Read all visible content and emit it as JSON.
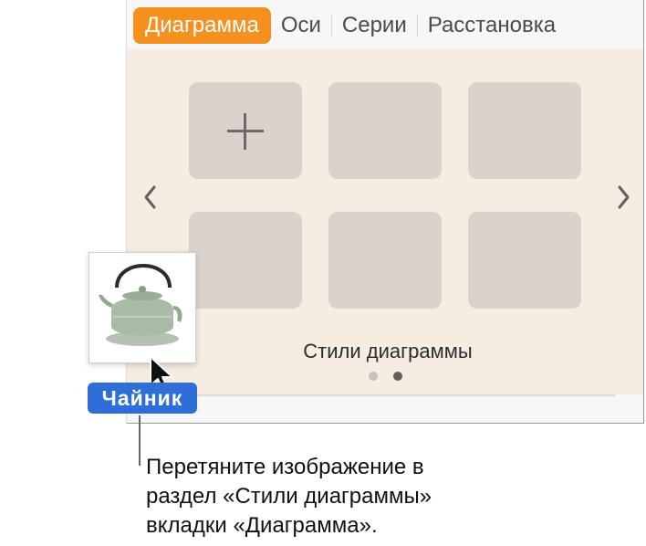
{
  "tabs": [
    {
      "label": "Диаграмма",
      "active": true
    },
    {
      "label": "Оси",
      "active": false
    },
    {
      "label": "Серии",
      "active": false
    },
    {
      "label": "Расстановка",
      "active": false
    }
  ],
  "styles_panel": {
    "label": "Стили диаграммы",
    "page_indicator": {
      "current": 2,
      "total": 2
    }
  },
  "drag": {
    "item_label": "Чайник",
    "image_icon": "teapot-image"
  },
  "callout": {
    "lines": [
      "Перетяните изображение в",
      "раздел «Стили диаграммы»",
      "вкладки «Диаграмма»."
    ]
  },
  "colors": {
    "active_tab": "#f6901f",
    "panel_bg": "#f6ece2",
    "tile": "#dbd3cb",
    "drag_label_bg": "#2d6fd6"
  }
}
